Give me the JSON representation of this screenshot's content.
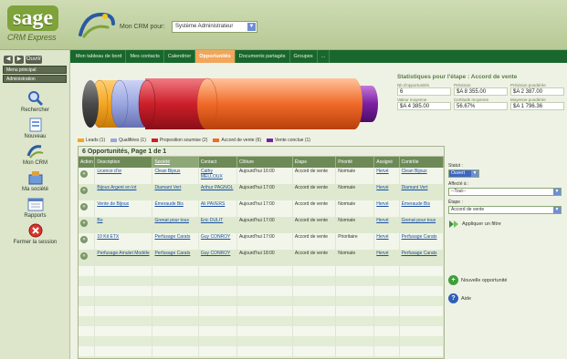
{
  "app": {
    "logo_text": "sage",
    "logo_sub": "CRM Express",
    "crm_label": "Mon CRM pour:",
    "profile": "Système Administrateur"
  },
  "sidebar": {
    "buttons": [
      "◀",
      "▶"
    ],
    "button_wide": "Ouvrir",
    "dropdowns": [
      "Menu principal",
      "Administration"
    ],
    "items": [
      {
        "label": "Rechercher",
        "icon": "magnifier-icon"
      },
      {
        "label": "Nouveau",
        "icon": "new-document-icon"
      },
      {
        "label": "Mon CRM",
        "icon": "swirl-icon"
      },
      {
        "label": "Ma société",
        "icon": "company-icon"
      },
      {
        "label": "Rapports",
        "icon": "calendar-report-icon"
      },
      {
        "label": "Fermer la session",
        "icon": "close-session-icon"
      }
    ]
  },
  "nav": {
    "tabs": [
      "Mon tableau de bord",
      "Mes contacts",
      "Calendrier",
      "Opportunités",
      "Documents partagés",
      "Groupes",
      "..."
    ],
    "active_index": 3
  },
  "legend": [
    {
      "label": "Leads (1)",
      "color": "#f5a623"
    },
    {
      "label": "Qualifiées (1)",
      "color": "#9aa6e0"
    },
    {
      "label": "Proposition soumise (2)",
      "color": "#cc1f2a"
    },
    {
      "label": "Accord de vente (6)",
      "color": "#f06a28"
    },
    {
      "label": "Vente conclue (1)",
      "color": "#7b1fa2"
    }
  ],
  "stats": {
    "title": "Statistiques pour l'étape : Accord de vente",
    "items": [
      {
        "label": "Nb d'opportunités",
        "value": "6"
      },
      {
        "label": "Prévision",
        "value": "$A 8 355.00"
      },
      {
        "label": "Prévision pondérée",
        "value": "$A 2 387.00"
      },
      {
        "label": "Valeur moyenne",
        "value": "$A 4 385.00"
      },
      {
        "label": "Certitude moyenne",
        "value": "56.67%"
      },
      {
        "label": "Moyenne pondérée",
        "value": "$A 1 796.36"
      }
    ]
  },
  "table": {
    "title": "6 Opportunités, Page 1 de 1",
    "columns": [
      "Action",
      "Description",
      "Société",
      "Contact",
      "Clôture",
      "Étape",
      "Priorité",
      "Assigné",
      "Contrôle"
    ],
    "sorted_index": 2,
    "rows": [
      {
        "description": "Licence d'or",
        "company": "Clean Bijoux",
        "contact": "Cathy MELLOUX",
        "closing": "Aujourd'hui 16:00",
        "stage": "Accord de vente",
        "priority": "Normale",
        "assigned": "Hervé",
        "controlled": "Clean Bijoux"
      },
      {
        "description": "Bijoux Argent en lot",
        "company": "Diamant Vert",
        "contact": "Arthur PAGNOL",
        "closing": "Aujourd'hui 17:00",
        "stage": "Accord de vente",
        "priority": "Normale",
        "assigned": "Hervé",
        "controlled": "Diamant Vert"
      },
      {
        "description": "Vente de Bijoux",
        "company": "Émeraude Bis",
        "contact": "Ali PAVERS",
        "closing": "Aujourd'hui 17:00",
        "stage": "Accord de vente",
        "priority": "Normale",
        "assigned": "Hervé",
        "controlled": "Émeraude Bis"
      },
      {
        "description": "Bo",
        "company": "Grenat pour tous",
        "contact": "Eric DULIT",
        "closing": "Aujourd'hui 17:00",
        "stage": "Accord de vente",
        "priority": "Normale",
        "assigned": "Hervé",
        "controlled": "Grenat pour tous"
      },
      {
        "description": "10 Kit ETX",
        "company": "Perfusage Carats",
        "contact": "Guy CONROY",
        "closing": "Aujourd'hui 17:00",
        "stage": "Accord de vente",
        "priority": "Prioritaire",
        "assigned": "Hervé",
        "controlled": "Perfusage Carats"
      },
      {
        "description": "Perfusage Amulet Modèle",
        "company": "Perfusage Carats",
        "contact": "Guy CONROY",
        "closing": "Aujourd'hui 18:00",
        "stage": "Accord de vente",
        "priority": "Normale",
        "assigned": "Hervé",
        "controlled": "Perfusage Carats"
      }
    ],
    "empty_rows": 10
  },
  "filters": {
    "status_label": "Statut :",
    "status_value": "Ouvert",
    "assigned_label": "Affecté à :",
    "assigned_value": "--Tout--",
    "stage_label": "Étape :",
    "stage_value": "Accord de vente",
    "apply_label": "Appliquer un filtre"
  },
  "actions": {
    "new_label": "Nouvelle opportunité",
    "help_label": "Aide"
  },
  "colors": {
    "nav_green": "#19672d",
    "accent_orange": "#f2a65a",
    "table_header": "#6d8a56"
  }
}
